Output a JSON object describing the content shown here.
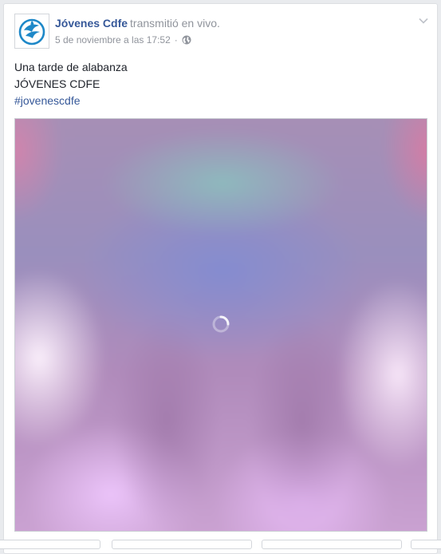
{
  "post": {
    "page_name": "Jóvenes Cdfe",
    "action": "transmitió en vivo.",
    "timestamp": "5 de noviembre a las 17:52",
    "separator": "·",
    "privacy_icon": "globe-icon",
    "menu_icon": "chevron-down-icon",
    "avatar_icon": "dove-flame-logo",
    "text_lines": [
      "Una tarde de alabanza",
      "JÓVENES CDFE"
    ],
    "hashtag": "#jovenescdfe"
  },
  "video": {
    "state": "loading",
    "loading_icon": "spinner-icon"
  },
  "colors": {
    "link_blue": "#365899",
    "meta_gray": "#90949c",
    "logo_blue": "#1e88c8",
    "page_bg": "#e9ebee"
  }
}
